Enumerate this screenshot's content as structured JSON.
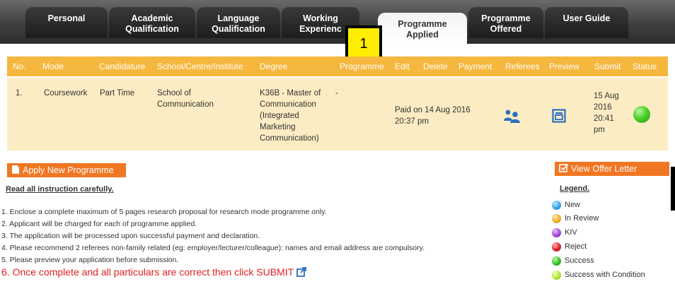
{
  "tabs": [
    {
      "line1": "Personal",
      "line2": ""
    },
    {
      "line1": "Academic",
      "line2": "Qualification"
    },
    {
      "line1": "Language",
      "line2": "Qualification"
    },
    {
      "line1": "Working",
      "line2": "Experienc"
    },
    {
      "line1": "Programme",
      "line2": "Applied"
    },
    {
      "line1": "Programme",
      "line2": "Offered"
    },
    {
      "line1": "User Guide",
      "line2": ""
    }
  ],
  "callout_label": "1",
  "table": {
    "headers": [
      "No.",
      "Mode",
      "Candidature",
      "School/Centre/Institute",
      "Degree",
      "Programme",
      "Edit",
      "Delete",
      "Payment",
      "Referees",
      "Preview",
      "Submit",
      "Status"
    ],
    "row": {
      "no": "1.",
      "mode": "Coursework",
      "candidature": "Part Time",
      "school": [
        "School of",
        "Communication"
      ],
      "degree": [
        "K36B - Master of",
        "Communication",
        "(Integrated",
        "Marketing",
        "Communication)"
      ],
      "programme": "-",
      "payment": [
        "Paid on 14 Aug 2016",
        "20:37 pm"
      ],
      "submit": [
        "15 Aug",
        "2016",
        "20:41",
        "pm"
      ],
      "status_color": "#3fc424"
    }
  },
  "buttons": {
    "apply": "Apply New Programme",
    "offer": "View Offer Letter"
  },
  "instructions": {
    "title": "Read all instruction carefully.",
    "items": [
      "1. Enclose a complete maximum of 5 pages research proposal for research mode programme only.",
      "2. Applicant will be charged for each of programme applied.",
      "3. The application will be processed upon successful payment and declaration.",
      "4. Please recommend 2 referees non-family related (eg: employer/lecturer/colleague): names and email address are compulsory.",
      "5. Please preview your application before submission."
    ],
    "final": "6. Once complete and all particulars are correct then click SUBMIT"
  },
  "legend": {
    "title": "Legend.",
    "items": [
      {
        "label": "New",
        "color": "#3aa7e8"
      },
      {
        "label": "In Review",
        "color": "#f5b02a"
      },
      {
        "label": "KIV",
        "color": "#a64ad6"
      },
      {
        "label": "Reject",
        "color": "#e0242a"
      },
      {
        "label": "Success",
        "color": "#35c020"
      },
      {
        "label": "Success with Condition",
        "color": "#b7e83a"
      }
    ]
  }
}
